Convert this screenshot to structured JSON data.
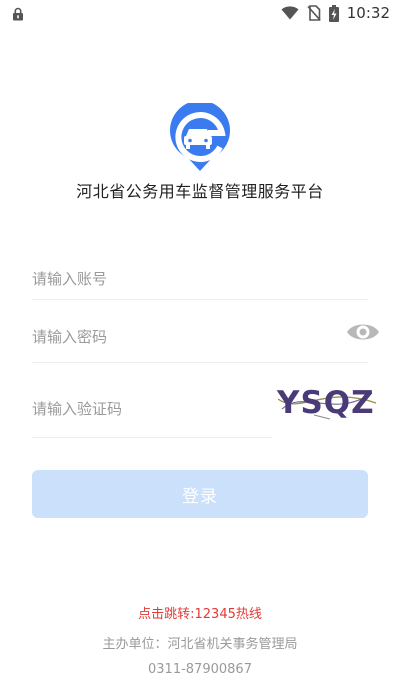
{
  "status_bar": {
    "time": "10:32",
    "icons": [
      "lock-icon",
      "wifi-icon",
      "no-sim-icon",
      "battery-charging-icon"
    ]
  },
  "app": {
    "logo_icon": "car-location-logo",
    "title": "河北省公务用车监督管理服务平台",
    "brand_color": "#3a7cf0"
  },
  "form": {
    "account_placeholder": "请输入账号",
    "account_value": "",
    "password_placeholder": "请输入密码",
    "password_value": "",
    "captcha_placeholder": "请输入验证码",
    "captcha_value": "",
    "captcha_text": "YSQZ",
    "eye_icon": "eye-icon"
  },
  "login_button": {
    "label": "登录",
    "background": "#cbe0fb"
  },
  "footer": {
    "hotline": "点击跳转:12345热线",
    "hotline_color": "#e53935",
    "sponsor": "主办单位：河北省机关事务管理局",
    "phone": "0311-87900867"
  }
}
